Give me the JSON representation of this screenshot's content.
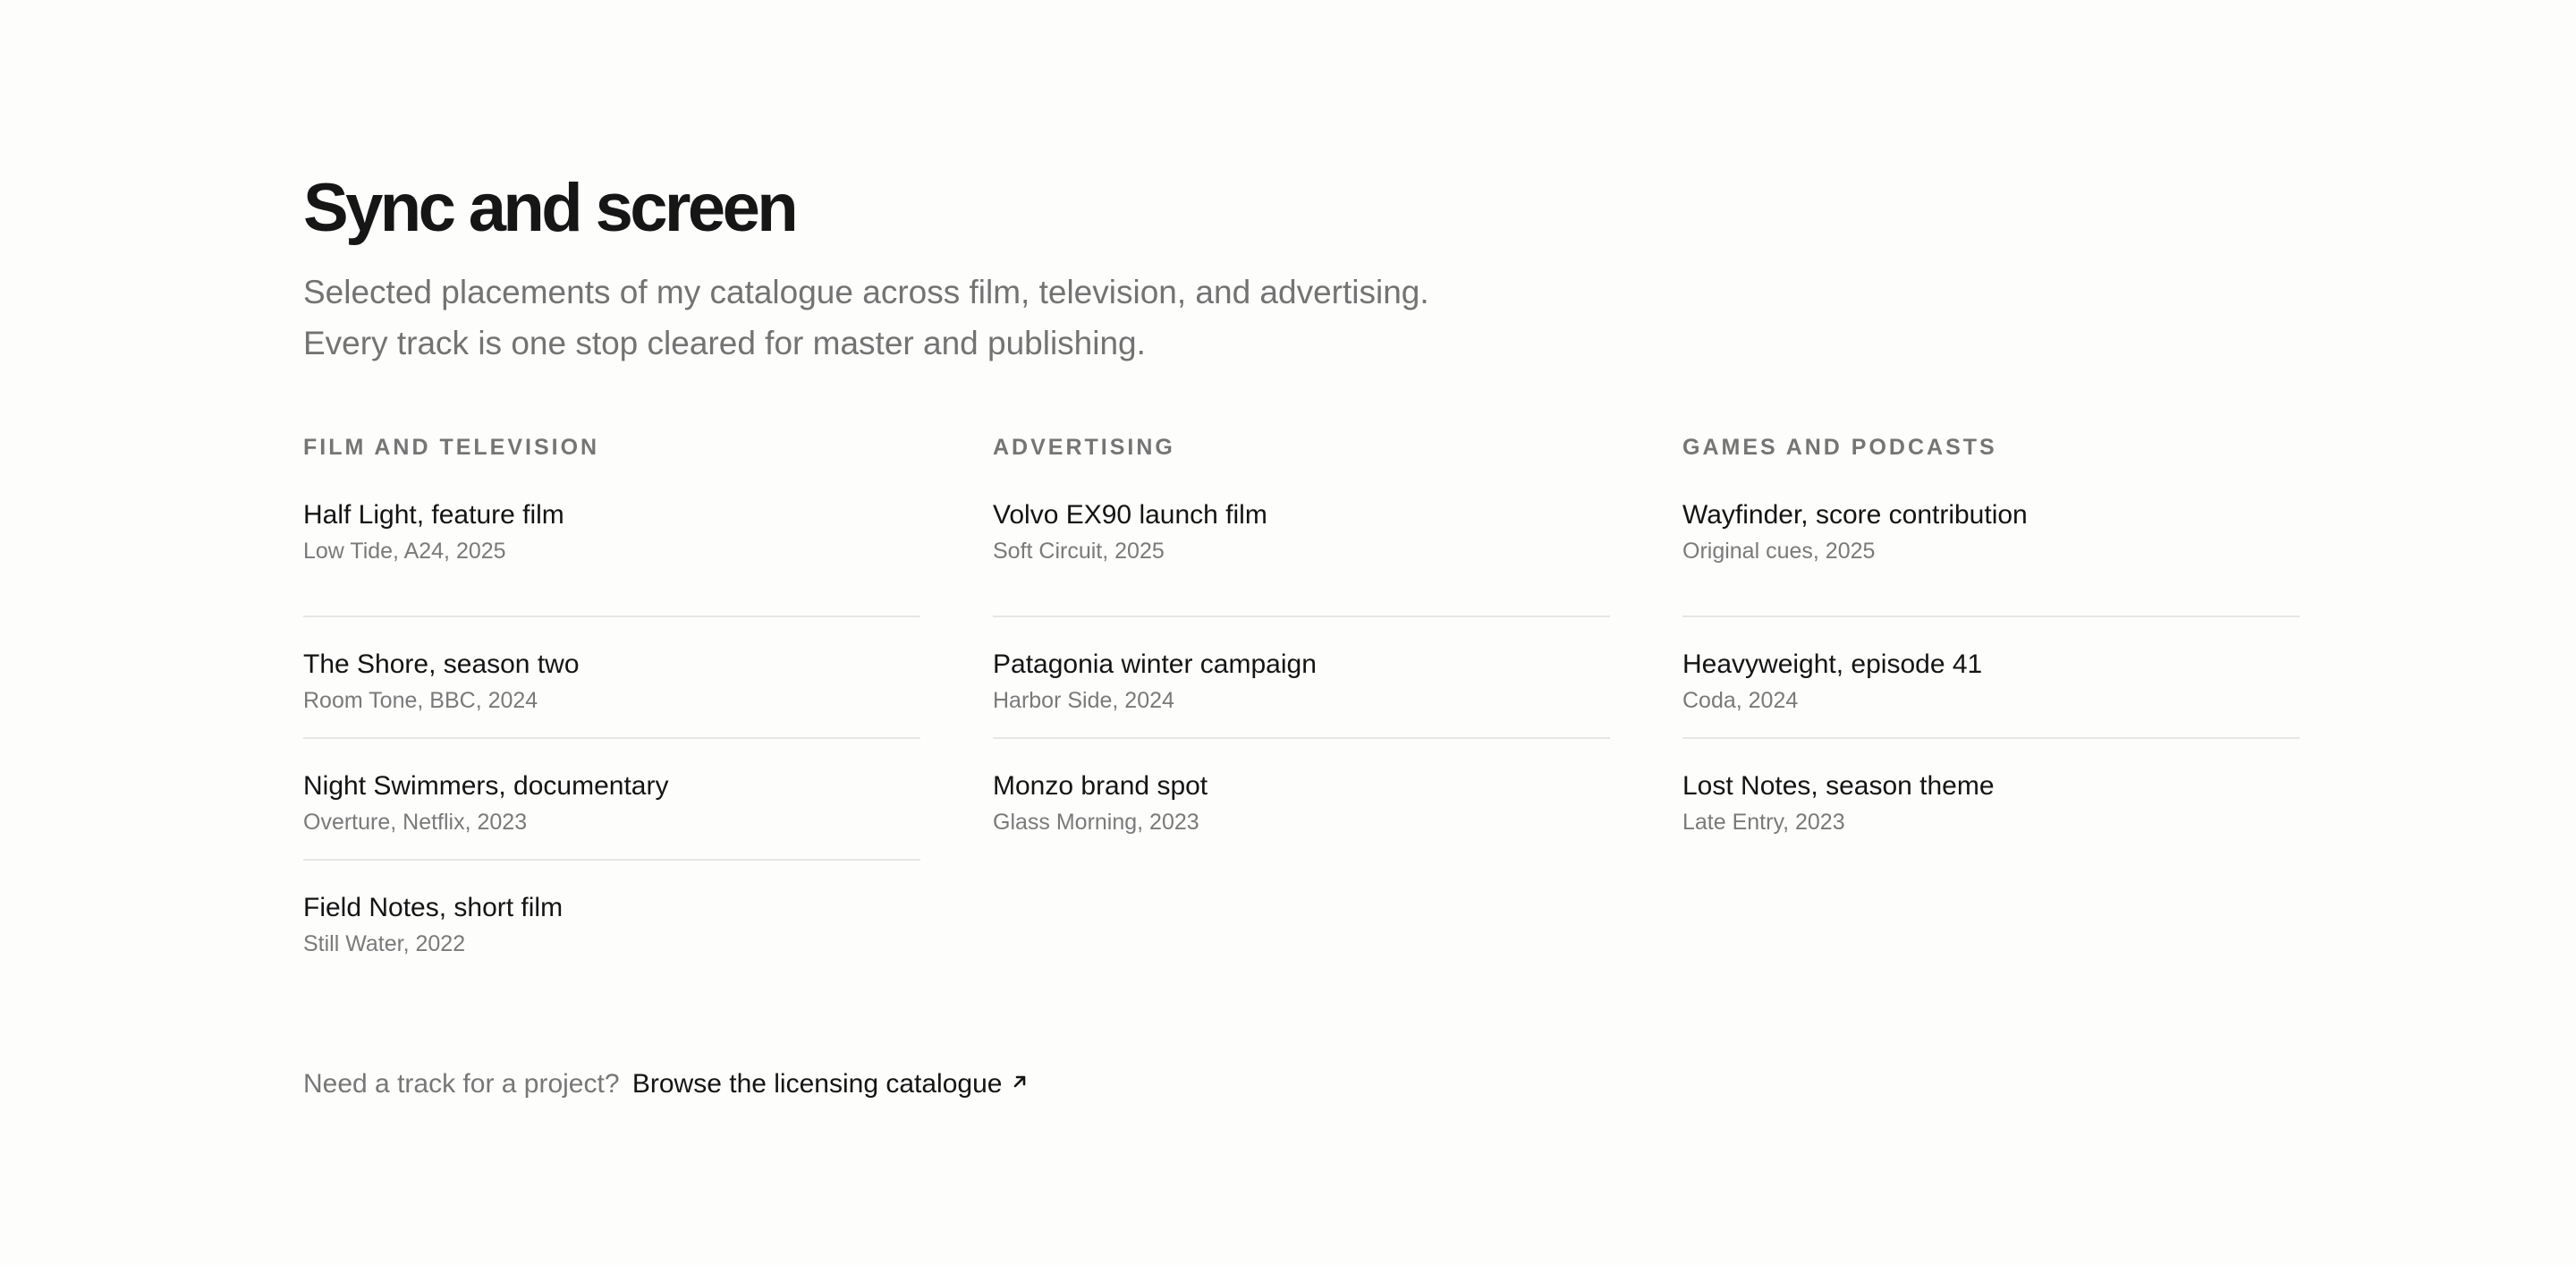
{
  "header": {
    "title": "Sync and screen",
    "intro_line1": "Selected placements of my catalogue across film, television, and advertising.",
    "intro_line2": "Every track is one stop cleared for master and publishing."
  },
  "columns": [
    {
      "heading": "FILM AND TELEVISION",
      "items": [
        {
          "title": "Half Light, feature film",
          "sub": "Low Tide, A24, 2025"
        },
        {
          "title": "The Shore, season two",
          "sub": "Room Tone, BBC, 2024"
        },
        {
          "title": "Night Swimmers, documentary",
          "sub": "Overture, Netflix, 2023"
        },
        {
          "title": "Field Notes, short film",
          "sub": "Still Water, 2022"
        }
      ]
    },
    {
      "heading": "ADVERTISING",
      "items": [
        {
          "title": "Volvo EX90 launch film",
          "sub": "Soft Circuit, 2025"
        },
        {
          "title": "Patagonia winter campaign",
          "sub": "Harbor Side, 2024"
        },
        {
          "title": "Monzo brand spot",
          "sub": "Glass Morning, 2023"
        }
      ]
    },
    {
      "heading": "GAMES AND PODCASTS",
      "items": [
        {
          "title": "Wayfinder, score contribution",
          "sub": "Original cues, 2025"
        },
        {
          "title": "Heavyweight, episode 41",
          "sub": "Coda, 2024"
        },
        {
          "title": "Lost Notes, season theme",
          "sub": "Late Entry, 2023"
        }
      ]
    }
  ],
  "footer": {
    "prompt": "Need a track for a project?",
    "link_label": "Browse the licensing catalogue",
    "link_icon": "arrow-up-right-icon"
  },
  "colors": {
    "background": "#fdfdfc",
    "heading": "#161616",
    "muted": "#737373",
    "divider": "#e6e6e4"
  }
}
